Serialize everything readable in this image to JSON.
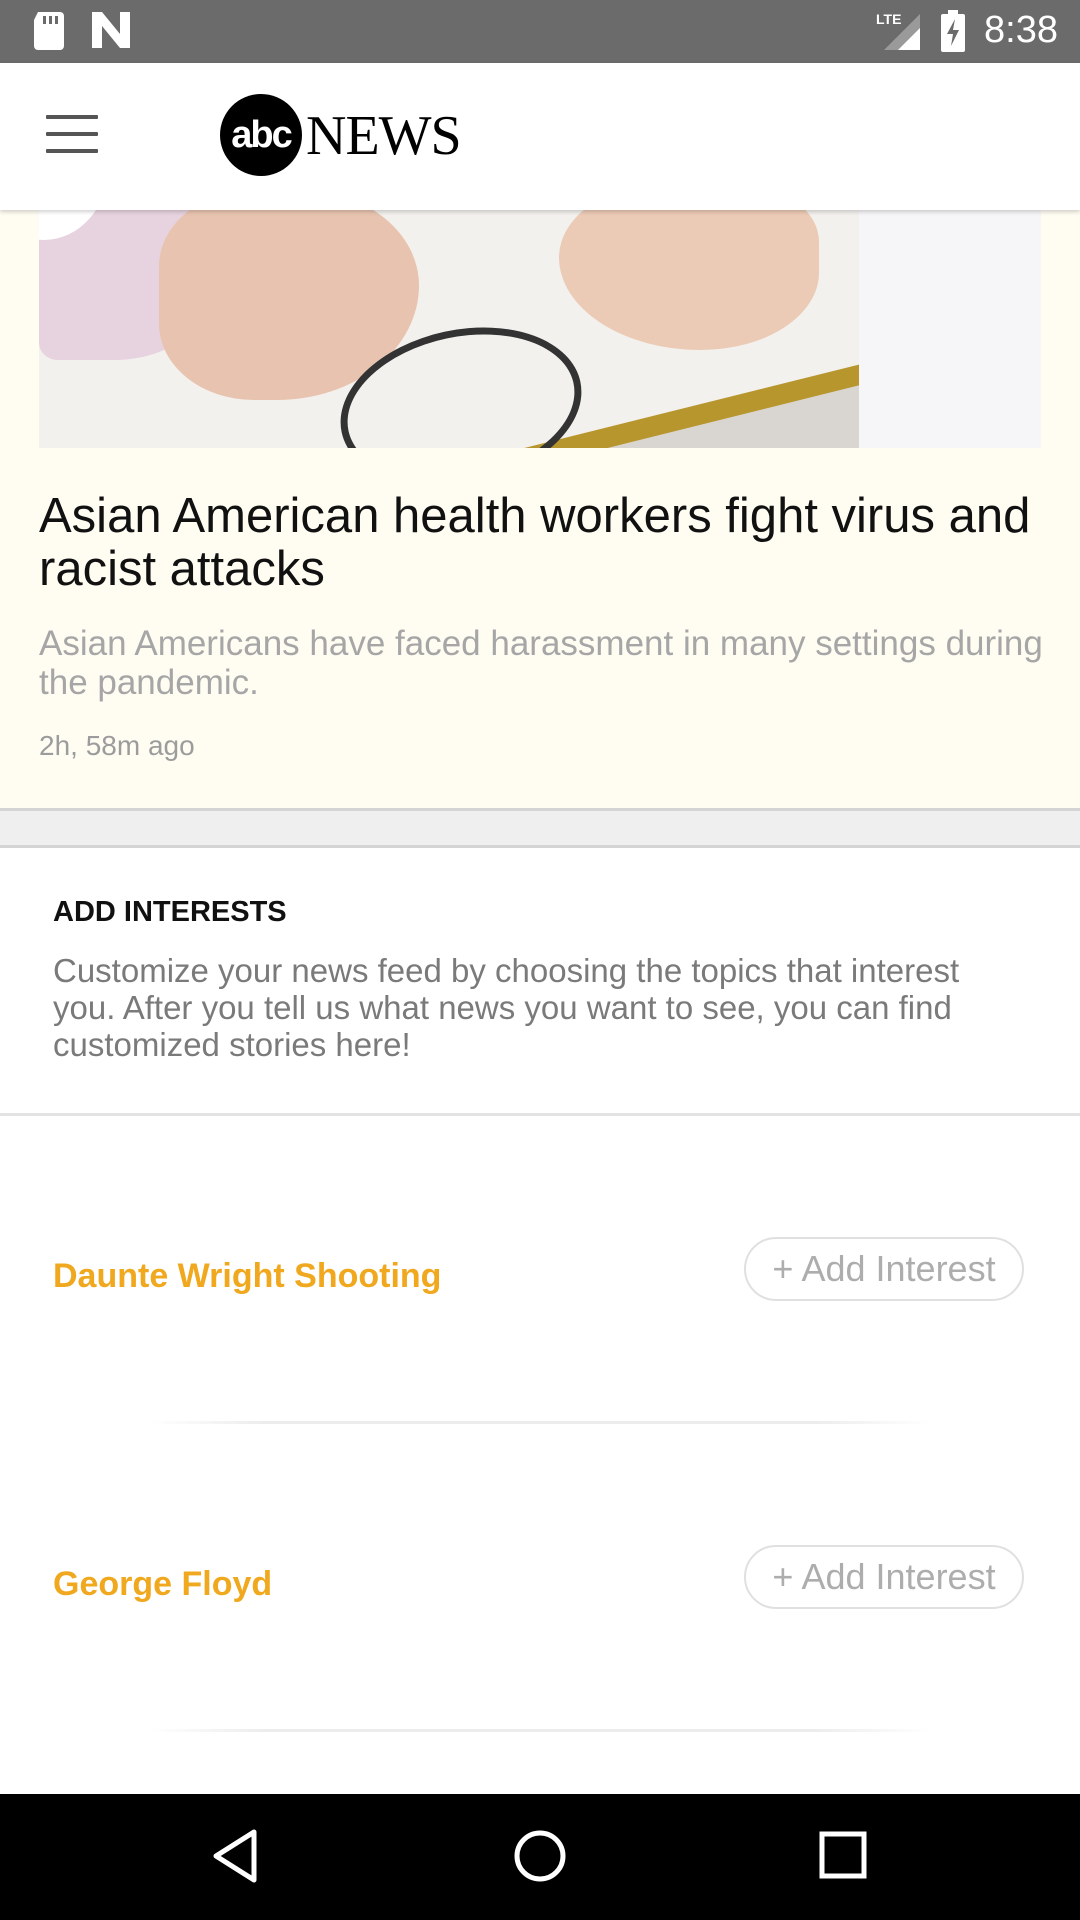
{
  "status_bar": {
    "network": "LTE",
    "time": "8:38",
    "icons": [
      "sd-card-icon",
      "n-icon",
      "lte-signal-icon",
      "battery-charging-icon"
    ]
  },
  "app_bar": {
    "menu_icon": "hamburger-menu-icon",
    "logo": {
      "abc": "abc",
      "news": "NEWS"
    }
  },
  "article": {
    "title": "Asian American health workers fight virus and racist attacks",
    "description": "Asian Americans have faced harassment in many settings during the pandemic.",
    "time_ago": "2h, 58m ago"
  },
  "interests": {
    "heading": "ADD INTERESTS",
    "description": "Customize your news feed by choosing the topics that interest you. After you tell us what news you want to see, you can find customized stories here!",
    "topics": [
      {
        "name": "Daunte Wright Shooting",
        "button": "+ Add Interest"
      },
      {
        "name": "George Floyd",
        "button": "+ Add Interest"
      }
    ]
  },
  "colors": {
    "topic": "#f0a81e",
    "status_bar": "#6b6b6b",
    "card_bg": "#fffdf2"
  },
  "nav_bar": {
    "icons": [
      "back-icon",
      "home-icon",
      "recents-icon"
    ]
  }
}
